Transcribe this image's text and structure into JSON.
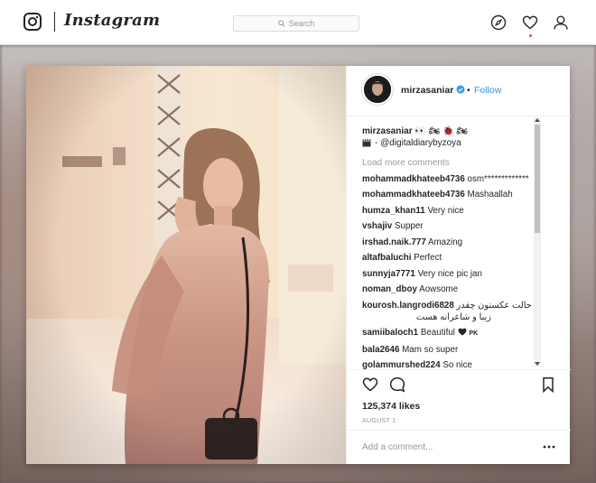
{
  "app": {
    "wordmark": "Instagram",
    "search_placeholder": "Search",
    "accent_color": "#3897f0",
    "notification_color": "#ed4956"
  },
  "nav": {
    "icons": [
      "instagram-logo-icon",
      "compass-icon",
      "heart-icon",
      "profile-icon"
    ]
  },
  "post": {
    "username": "mirzasaniar",
    "follow_separator": "•",
    "follow_label": "Follow",
    "caption": {
      "username": "mirzasaniar",
      "emojis": "👀 🏍 🐞 🏍",
      "credit": "- @digitaldiarybyzoya"
    },
    "load_more": "Load more comments",
    "comments": [
      {
        "user": "mohammadkhateeb4736",
        "text": "osm*************"
      },
      {
        "user": "mohammadkhateeb4736",
        "text": "Mashaallah"
      },
      {
        "user": "humza_khan11",
        "text": "Very nice"
      },
      {
        "user": "vshajiv",
        "text": "Supper"
      },
      {
        "user": "irshad.naik.777",
        "text": "Amazing"
      },
      {
        "user": "altafbaluchi",
        "text": "Perfect"
      },
      {
        "user": "sunnyja7771",
        "text": "Very nice pic jan"
      },
      {
        "user": "noman_dboy",
        "text": "Aowsome"
      },
      {
        "user": "kourosh.langrodi6828",
        "text": "حالت عکستون چقدر",
        "text2": "زیبا و شاعرانه هست"
      },
      {
        "user": "samiibaloch1",
        "text": "Beautiful",
        "suffix": "PK"
      },
      {
        "user": "bala2646",
        "text": "Mam so super"
      },
      {
        "user": "golammurshed224",
        "text": "So nice"
      }
    ],
    "likes": "125,374 likes",
    "date": "AUGUST 1",
    "add_comment_placeholder": "Add a comment..."
  }
}
